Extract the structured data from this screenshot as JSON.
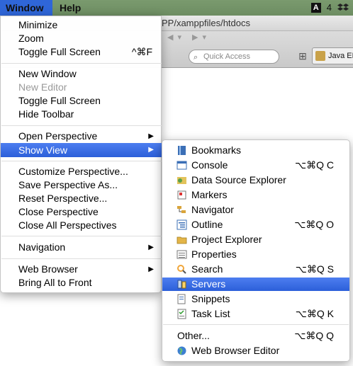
{
  "menubar": {
    "window_label": "Window",
    "help_label": "Help",
    "adobe_icon": "A",
    "adobe_count": "4",
    "dropbox_icon": "dropbox-icon"
  },
  "window_title": {
    "path": "PP/xamppfiles/htdocs"
  },
  "toolbar": {
    "quick_access_placeholder": "Quick Access",
    "perspective_label": "Java EE"
  },
  "window_menu": {
    "items": [
      {
        "label": "Minimize",
        "shortcut": ""
      },
      {
        "label": "Zoom",
        "shortcut": ""
      },
      {
        "label": "Toggle Full Screen",
        "shortcut": "^⌘F"
      },
      {
        "label": "New Window",
        "shortcut": ""
      },
      {
        "label": "New Editor",
        "shortcut": "",
        "disabled": true
      },
      {
        "label": "Toggle Full Screen",
        "shortcut": ""
      },
      {
        "label": "Hide Toolbar",
        "shortcut": ""
      },
      {
        "label": "Open Perspective",
        "submenu": true
      },
      {
        "label": "Show View",
        "submenu": true,
        "highlighted": true
      },
      {
        "label": "Customize Perspective...",
        "shortcut": ""
      },
      {
        "label": "Save Perspective As...",
        "shortcut": ""
      },
      {
        "label": "Reset Perspective...",
        "shortcut": ""
      },
      {
        "label": "Close Perspective",
        "shortcut": ""
      },
      {
        "label": "Close All Perspectives",
        "shortcut": ""
      },
      {
        "label": "Navigation",
        "submenu": true
      },
      {
        "label": "Web Browser",
        "submenu": true
      },
      {
        "label": "Bring All to Front",
        "shortcut": ""
      }
    ],
    "submenu_arrow": "▶"
  },
  "show_view_menu": {
    "items": [
      {
        "label": "Bookmarks",
        "shortcut": "",
        "icon": "bookmarks-icon"
      },
      {
        "label": "Console",
        "shortcut": "⌥⌘Q C",
        "icon": "console-icon"
      },
      {
        "label": "Data Source Explorer",
        "shortcut": "",
        "icon": "data-source-icon"
      },
      {
        "label": "Markers",
        "shortcut": "",
        "icon": "markers-icon"
      },
      {
        "label": "Navigator",
        "shortcut": "",
        "icon": "navigator-icon"
      },
      {
        "label": "Outline",
        "shortcut": "⌥⌘Q O",
        "icon": "outline-icon"
      },
      {
        "label": "Project Explorer",
        "shortcut": "",
        "icon": "project-explorer-icon"
      },
      {
        "label": "Properties",
        "shortcut": "",
        "icon": "properties-icon"
      },
      {
        "label": "Search",
        "shortcut": "⌥⌘Q S",
        "icon": "search-icon"
      },
      {
        "label": "Servers",
        "shortcut": "",
        "icon": "servers-icon",
        "highlighted": true
      },
      {
        "label": "Snippets",
        "shortcut": "",
        "icon": "snippets-icon"
      },
      {
        "label": "Task List",
        "shortcut": "⌥⌘Q K",
        "icon": "task-list-icon"
      },
      {
        "label": "Other...",
        "shortcut": "⌥⌘Q Q",
        "icon": ""
      },
      {
        "label": "Web Browser Editor",
        "shortcut": "",
        "icon": "globe-icon"
      }
    ]
  },
  "colors": {
    "highlight": "#2f66d8",
    "menubar": "#7a9a6e"
  }
}
